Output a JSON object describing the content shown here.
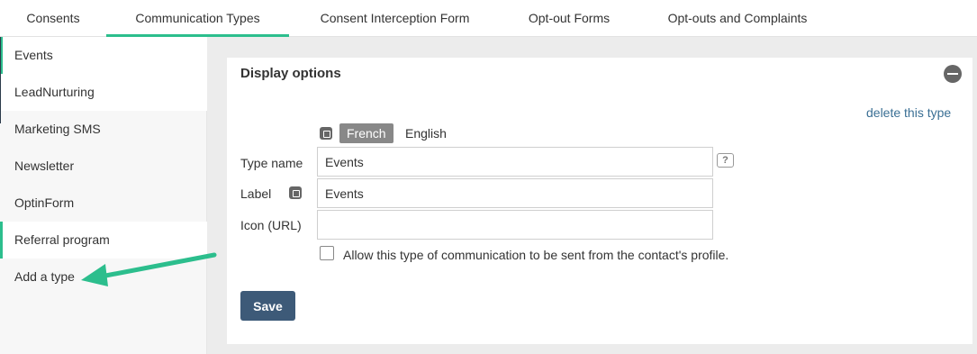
{
  "tabs": [
    {
      "label": "Consents"
    },
    {
      "label": "Communication Types",
      "active": true
    },
    {
      "label": "Consent Interception Form"
    },
    {
      "label": "Opt-out Forms"
    },
    {
      "label": "Opt-outs and Complaints"
    }
  ],
  "sidebar": {
    "items": [
      {
        "label": "Events"
      },
      {
        "label": "LeadNurturing"
      },
      {
        "label": "Marketing SMS"
      },
      {
        "label": "Newsletter"
      },
      {
        "label": "OptinForm"
      },
      {
        "label": "Referral program"
      },
      {
        "label": "Add a type"
      }
    ]
  },
  "panel": {
    "title": "Display options",
    "collapse_icon": "minus-circle-icon",
    "delete_label": "delete this type",
    "languages": {
      "active": "French",
      "other": "English"
    },
    "fields": {
      "type_name": {
        "label": "Type name",
        "value": "Events"
      },
      "label": {
        "label": "Label",
        "value": "Events"
      },
      "icon_url": {
        "label": "Icon (URL)",
        "value": ""
      }
    },
    "help_glyph": "?",
    "checkbox": {
      "label": "Allow this type of communication to be sent from the contact's profile.",
      "checked": false
    },
    "save_label": "Save"
  },
  "colors": {
    "accent": "#2cbe8d",
    "save_button": "#3d5a78",
    "link": "#3a6f94",
    "arrow": "#2cbe8d"
  }
}
